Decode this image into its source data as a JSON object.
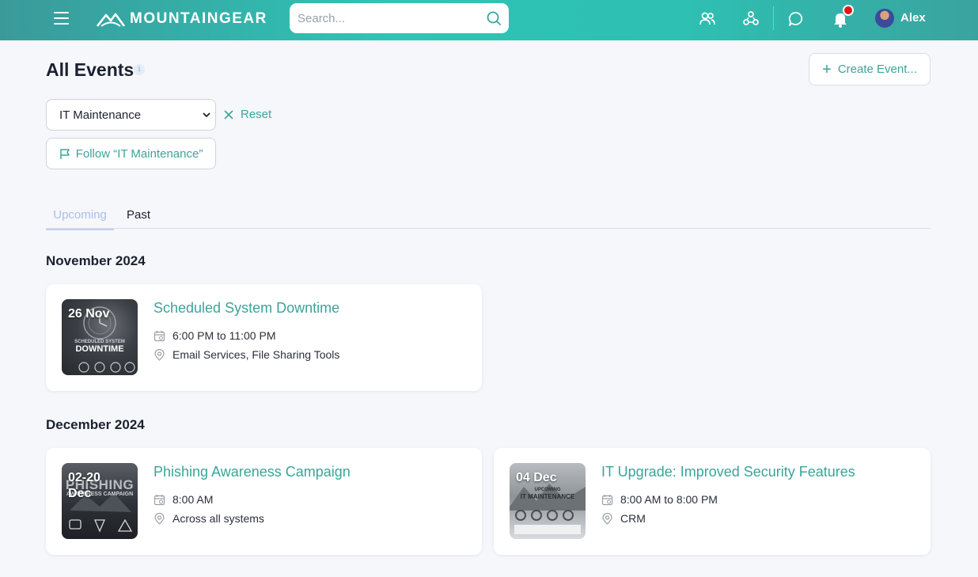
{
  "header": {
    "logo_text": "MOUNTAINGEAR",
    "search_placeholder": "Search...",
    "user_name": "Alex"
  },
  "page": {
    "title": "All Events",
    "create_button": "Create Event..."
  },
  "filter": {
    "selected_category": "IT Maintenance",
    "reset_label": "Reset",
    "follow_label": "Follow “IT Maintenance”"
  },
  "tabs": [
    {
      "label": "Upcoming",
      "active": true
    },
    {
      "label": "Past",
      "active": false
    }
  ],
  "months": [
    {
      "label": "November 2024",
      "events": [
        {
          "thumb_date": "26 Nov",
          "thumb_caption_1": "SCHEDULED SYSTEM",
          "thumb_caption_2": "DOWNTIME",
          "title": "Scheduled System Downtime",
          "time": "6:00 PM to 11:00 PM",
          "location": "Email Services, File Sharing Tools"
        }
      ]
    },
    {
      "label": "December 2024",
      "events": [
        {
          "thumb_date": "02-20 Dec",
          "thumb_caption_1": "PHISHING",
          "thumb_caption_2": "AWARENESS CAMPAIGN",
          "title": "Phishing Awareness Campaign",
          "time": "8:00 AM",
          "location": "Across all systems"
        },
        {
          "thumb_date": "04 Dec",
          "thumb_caption_1": "UPCOMING",
          "thumb_caption_2": "IT MAINTENANCE",
          "title": "IT Upgrade: Improved Security Features",
          "time": "8:00 AM to 8:00 PM",
          "location": "CRM"
        }
      ]
    }
  ],
  "icons": {
    "menu": "hamburger-icon",
    "search": "search-icon",
    "people": "people-icon",
    "groups": "groups-icon",
    "chat": "chat-icon",
    "bell": "bell-icon",
    "calendar": "calendar-icon",
    "location": "location-pin-icon"
  },
  "colors": {
    "accent": "#3aa59a",
    "header_start": "#3a9a9a",
    "header_mid": "#2fc4b6",
    "notification": "#e0161a",
    "tab_active": "#a8c0e8"
  }
}
